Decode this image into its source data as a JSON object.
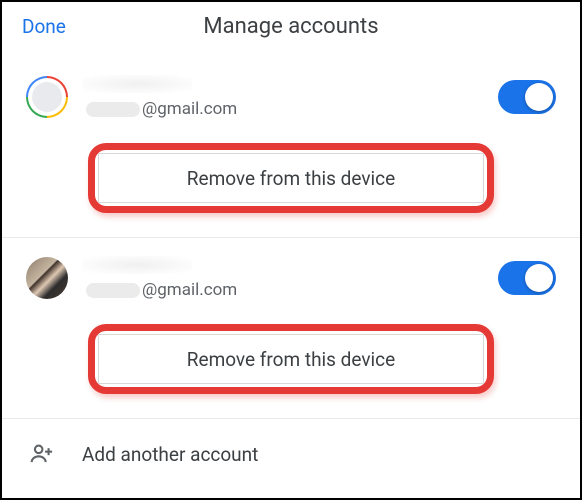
{
  "header": {
    "done_label": "Done",
    "title": "Manage accounts"
  },
  "accounts": [
    {
      "email_suffix": "@gmail.com",
      "toggle_on": true,
      "remove_label": "Remove from this device"
    },
    {
      "email_suffix": "@gmail.com",
      "toggle_on": true,
      "remove_label": "Remove from this device"
    }
  ],
  "add_account": {
    "label": "Add another account"
  }
}
